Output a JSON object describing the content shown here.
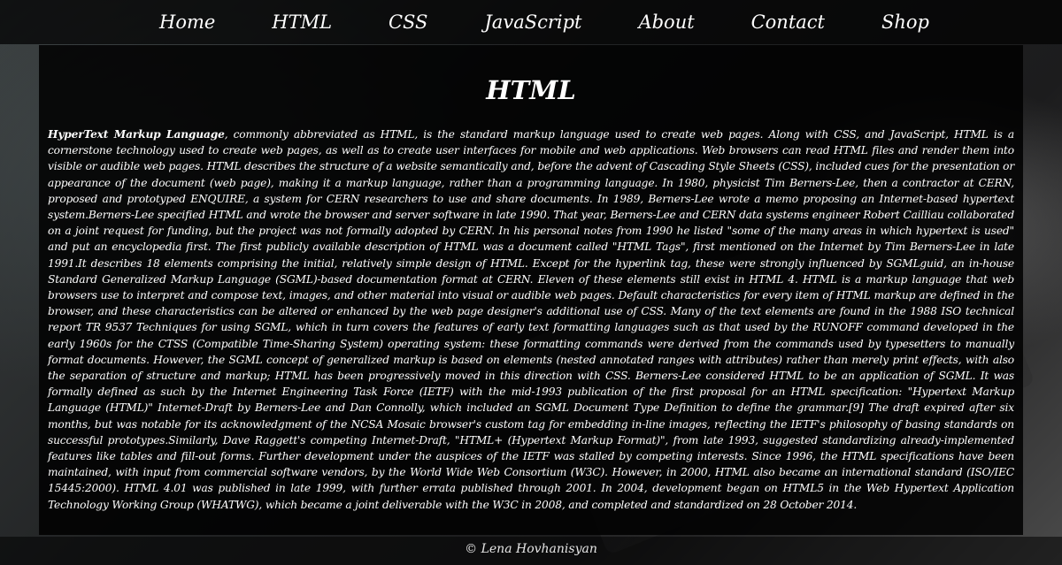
{
  "nav": {
    "items": [
      {
        "label": "Home"
      },
      {
        "label": "HTML"
      },
      {
        "label": "CSS"
      },
      {
        "label": "JavaScript"
      },
      {
        "label": "About"
      },
      {
        "label": "Contact"
      },
      {
        "label": "Shop"
      }
    ]
  },
  "main": {
    "title": "HTML",
    "lead_term": "HyperText Markup Language",
    "body": ", commonly abbreviated as HTML, is the standard markup language used to create web pages. Along with CSS, and JavaScript, HTML is a cornerstone technology used to create web pages, as well as to create user interfaces for mobile and web applications. Web browsers can read HTML files and render them into visible or audible web pages. HTML describes the structure of a website semantically and, before the advent of Cascading Style Sheets (CSS), included cues for the presentation or appearance of the document (web page), making it a markup language, rather than a programming language. In 1980, physicist Tim Berners-Lee, then a contractor at CERN, proposed and prototyped ENQUIRE, a system for CERN researchers to use and share documents. In 1989, Berners-Lee wrote a memo proposing an Internet-based hypertext system.Berners-Lee specified HTML and wrote the browser and server software in late 1990. That year, Berners-Lee and CERN data systems engineer Robert Cailliau collaborated on a joint request for funding, but the project was not formally adopted by CERN. In his personal notes from 1990 he listed \"some of the many areas in which hypertext is used\" and put an encyclopedia first. The first publicly available description of HTML was a document called \"HTML Tags\", first mentioned on the Internet by Tim Berners-Lee in late 1991.It describes 18 elements comprising the initial, relatively simple design of HTML. Except for the hyperlink tag, these were strongly influenced by SGMLguid, an in-house Standard Generalized Markup Language (SGML)-based documentation format at CERN. Eleven of these elements still exist in HTML 4. HTML is a markup language that web browsers use to interpret and compose text, images, and other material into visual or audible web pages. Default characteristics for every item of HTML markup are defined in the browser, and these characteristics can be altered or enhanced by the web page designer's additional use of CSS. Many of the text elements are found in the 1988 ISO technical report TR 9537 Techniques for using SGML, which in turn covers the features of early text formatting languages such as that used by the RUNOFF command developed in the early 1960s for the CTSS (Compatible Time-Sharing System) operating system: these formatting commands were derived from the commands used by typesetters to manually format documents. However, the SGML concept of generalized markup is based on elements (nested annotated ranges with attributes) rather than merely print effects, with also the separation of structure and markup; HTML has been progressively moved in this direction with CSS. Berners-Lee considered HTML to be an application of SGML. It was formally defined as such by the Internet Engineering Task Force (IETF) with the mid-1993 publication of the first proposal for an HTML specification: \"Hypertext Markup Language (HTML)\" Internet-Draft by Berners-Lee and Dan Connolly, which included an SGML Document Type Definition to define the grammar.[9] The draft expired after six months, but was notable for its acknowledgment of the NCSA Mosaic browser's custom tag for embedding in-line images, reflecting the IETF's philosophy of basing standards on successful prototypes.Similarly, Dave Raggett's competing Internet-Draft, \"HTML+ (Hypertext Markup Format)\", from late 1993, suggested standardizing already-implemented features like tables and fill-out forms. Further development under the auspices of the IETF was stalled by competing interests. Since 1996, the HTML specifications have been maintained, with input from commercial software vendors, by the World Wide Web Consortium (W3C). However, in 2000, HTML also became an international standard (ISO/IEC 15445:2000). HTML 4.01 was published in late 1999, with further errata published through 2001. In 2004, development began on HTML5 in the Web Hypertext Application Technology Working Group (WHATWG), which became a joint deliverable with the W3C in 2008, and completed and standardized on 28 October 2014."
  },
  "footer": {
    "text": "© Lena Hovhanisyan"
  }
}
